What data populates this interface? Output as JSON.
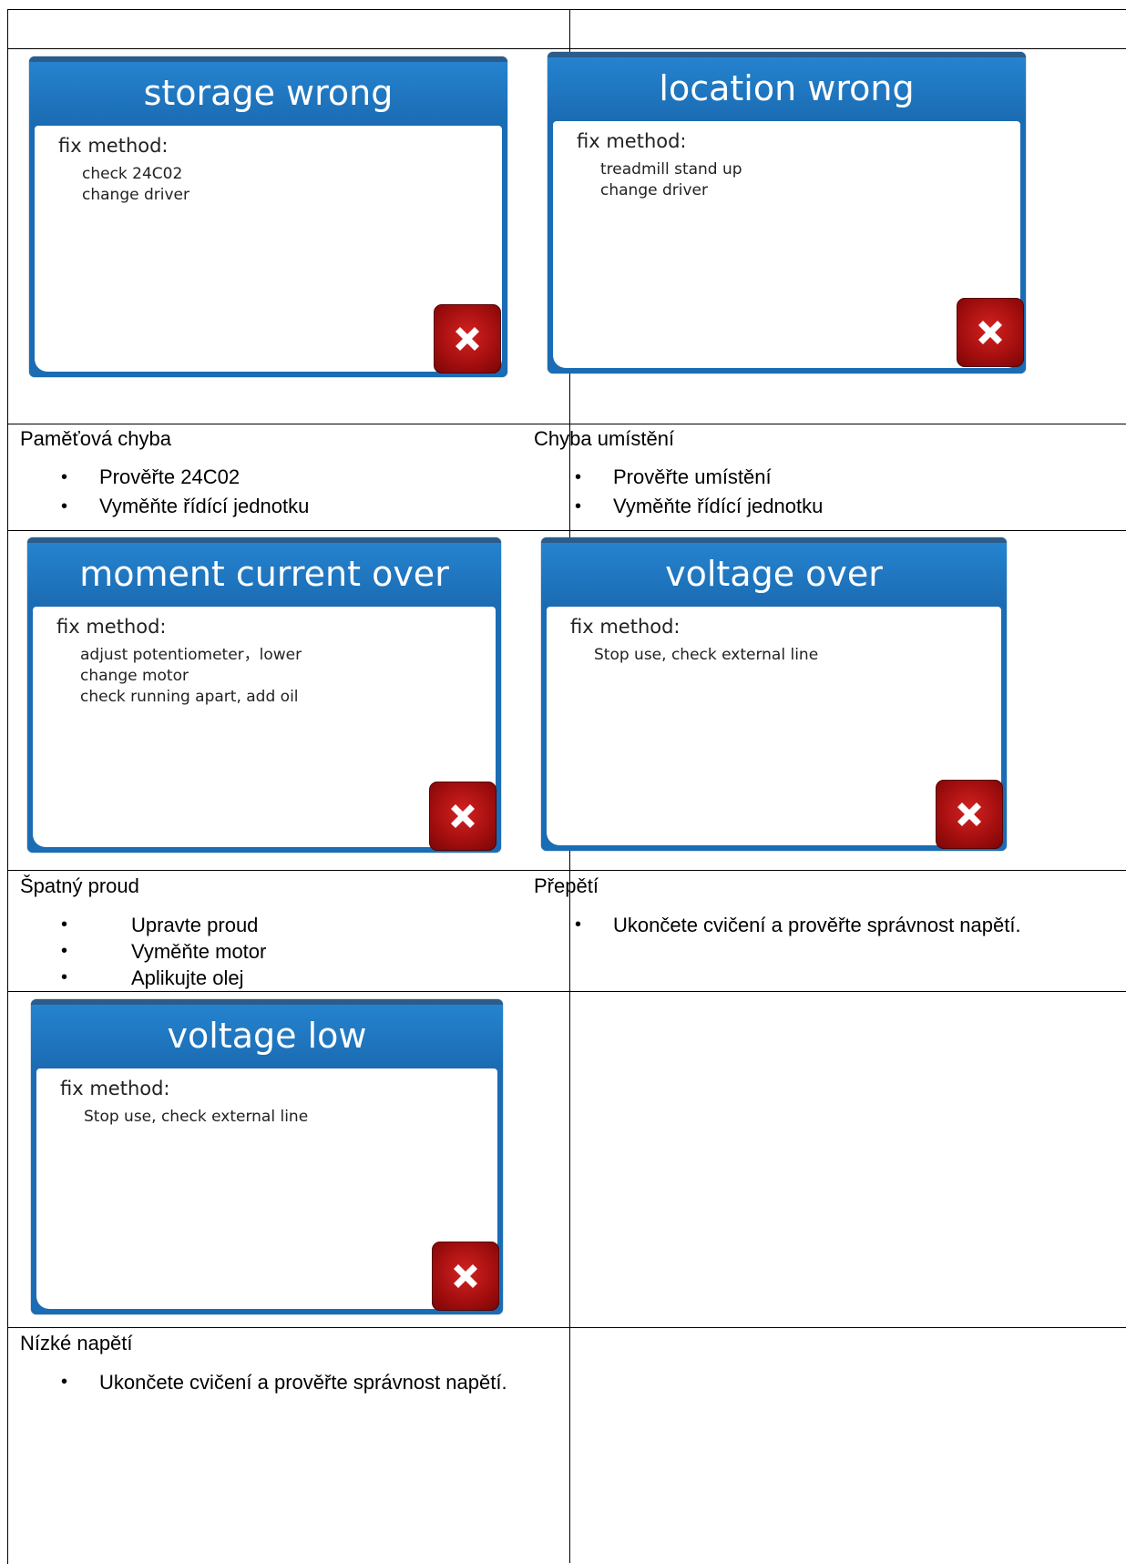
{
  "cells": [
    {
      "screen": {
        "title": "storage wrong",
        "fix_label": "fix method:",
        "steps": [
          "check 24C02",
          "change driver"
        ]
      },
      "caption": {
        "title": "Paměťová chyba",
        "bullets": [
          "Prověřte 24C02",
          "Vyměňte řídící jednotku"
        ]
      }
    },
    {
      "screen": {
        "title": "location wrong",
        "fix_label": "fix method:",
        "steps": [
          "treadmill stand up",
          "change driver"
        ]
      },
      "caption": {
        "title": "Chyba umístění",
        "bullets": [
          "Prověřte umístění",
          "Vyměňte řídící jednotku"
        ]
      }
    },
    {
      "screen": {
        "title": "moment current over",
        "fix_label": "fix method:",
        "steps": [
          "adjust potentiometer，lower",
          "change motor",
          "check running apart, add oil"
        ]
      },
      "caption": {
        "title": "Špatný proud",
        "bullets": [
          "Upravte proud",
          "Vyměňte motor",
          "Aplikujte olej"
        ]
      }
    },
    {
      "screen": {
        "title": "voltage over",
        "fix_label": "fix method:",
        "steps": [
          "Stop use, check external line"
        ]
      },
      "caption": {
        "title": "Přepětí",
        "bullets": [
          "Ukončete cvičení a prověřte správnost napětí."
        ]
      }
    },
    {
      "screen": {
        "title": "voltage low",
        "fix_label": "fix method:",
        "steps": [
          "Stop use, check external line"
        ]
      },
      "caption": {
        "title": "Nízké napětí",
        "bullets": [
          "Ukončete cvičení a prověřte správnost napětí."
        ]
      }
    }
  ],
  "icons": {
    "close": "close-x-icon"
  },
  "colors": {
    "header_blue": "#1b6cb3",
    "close_red": "#a30e0e"
  }
}
